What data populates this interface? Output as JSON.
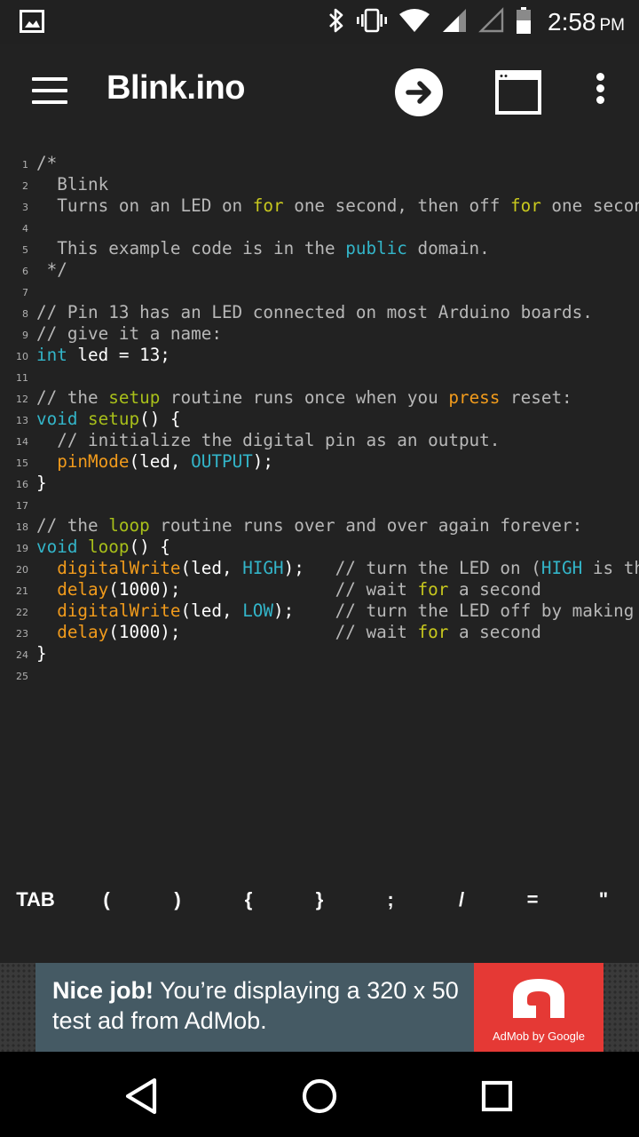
{
  "status_bar": {
    "time": "2:58",
    "ampm": "PM",
    "icons": [
      "image-notification-icon",
      "bluetooth-icon",
      "vibrate-icon",
      "wifi-icon",
      "signal-icon",
      "signal-empty-icon",
      "battery-icon"
    ]
  },
  "app_bar": {
    "title": "Blink.ino",
    "icons": [
      "menu-icon",
      "upload-arrow-icon",
      "serial-monitor-icon",
      "more-vert-icon"
    ]
  },
  "editor": {
    "lines": [
      {
        "n": "1",
        "tokens": [
          {
            "t": "/*",
            "c": "comment"
          }
        ]
      },
      {
        "n": "2",
        "tokens": [
          {
            "t": "  Blink",
            "c": "comment"
          }
        ]
      },
      {
        "n": "3",
        "tokens": [
          {
            "t": "  Turns on an LED on ",
            "c": "comment"
          },
          {
            "t": "for",
            "c": "keyword"
          },
          {
            "t": " one second, then off ",
            "c": "comment"
          },
          {
            "t": "for",
            "c": "keyword"
          },
          {
            "t": " one second, repeatedly.",
            "c": "comment"
          }
        ]
      },
      {
        "n": "4",
        "tokens": []
      },
      {
        "n": "5",
        "tokens": [
          {
            "t": "  This example code is in the ",
            "c": "comment"
          },
          {
            "t": "public",
            "c": "type"
          },
          {
            "t": " domain.",
            "c": "comment"
          }
        ]
      },
      {
        "n": "6",
        "tokens": [
          {
            "t": " */",
            "c": "comment"
          }
        ]
      },
      {
        "n": "7",
        "tokens": []
      },
      {
        "n": "8",
        "tokens": [
          {
            "t": "// Pin 13 has an LED connected on most Arduino boards.",
            "c": "comment"
          }
        ]
      },
      {
        "n": "9",
        "tokens": [
          {
            "t": "// give it a name:",
            "c": "comment"
          }
        ]
      },
      {
        "n": "10",
        "tokens": [
          {
            "t": "int",
            "c": "type"
          },
          {
            "t": " led = 13;",
            "c": "plain"
          }
        ]
      },
      {
        "n": "11",
        "tokens": []
      },
      {
        "n": "12",
        "tokens": [
          {
            "t": "// the ",
            "c": "comment"
          },
          {
            "t": "setup",
            "c": "kwgreen"
          },
          {
            "t": " routine runs once when you ",
            "c": "comment"
          },
          {
            "t": "press",
            "c": "func"
          },
          {
            "t": " reset:",
            "c": "comment"
          }
        ]
      },
      {
        "n": "13",
        "tokens": [
          {
            "t": "void",
            "c": "type"
          },
          {
            "t": " ",
            "c": "plain"
          },
          {
            "t": "setup",
            "c": "kwgreen"
          },
          {
            "t": "() {",
            "c": "plain"
          }
        ]
      },
      {
        "n": "14",
        "tokens": [
          {
            "t": "  // initialize the digital pin as an output.",
            "c": "comment"
          }
        ]
      },
      {
        "n": "15",
        "tokens": [
          {
            "t": "  ",
            "c": "plain"
          },
          {
            "t": "pinMode",
            "c": "func"
          },
          {
            "t": "(led, ",
            "c": "plain"
          },
          {
            "t": "OUTPUT",
            "c": "const"
          },
          {
            "t": ");",
            "c": "plain"
          }
        ]
      },
      {
        "n": "16",
        "tokens": [
          {
            "t": "}",
            "c": "plain"
          }
        ]
      },
      {
        "n": "17",
        "tokens": []
      },
      {
        "n": "18",
        "tokens": [
          {
            "t": "// the ",
            "c": "comment"
          },
          {
            "t": "loop",
            "c": "kwgreen"
          },
          {
            "t": " routine runs over and over again forever:",
            "c": "comment"
          }
        ]
      },
      {
        "n": "19",
        "tokens": [
          {
            "t": "void",
            "c": "type"
          },
          {
            "t": " ",
            "c": "plain"
          },
          {
            "t": "loop",
            "c": "kwgreen"
          },
          {
            "t": "() {",
            "c": "plain"
          }
        ]
      },
      {
        "n": "20",
        "tokens": [
          {
            "t": "  ",
            "c": "plain"
          },
          {
            "t": "digitalWrite",
            "c": "func"
          },
          {
            "t": "(led, ",
            "c": "plain"
          },
          {
            "t": "HIGH",
            "c": "const"
          },
          {
            "t": ");   ",
            "c": "plain"
          },
          {
            "t": "// turn the LED on (",
            "c": "comment"
          },
          {
            "t": "HIGH",
            "c": "const"
          },
          {
            "t": " is the voltage level)",
            "c": "comment"
          }
        ]
      },
      {
        "n": "21",
        "tokens": [
          {
            "t": "  ",
            "c": "plain"
          },
          {
            "t": "delay",
            "c": "func"
          },
          {
            "t": "(1000);               ",
            "c": "plain"
          },
          {
            "t": "// wait ",
            "c": "comment"
          },
          {
            "t": "for",
            "c": "keyword"
          },
          {
            "t": " a second",
            "c": "comment"
          }
        ]
      },
      {
        "n": "22",
        "tokens": [
          {
            "t": "  ",
            "c": "plain"
          },
          {
            "t": "digitalWrite",
            "c": "func"
          },
          {
            "t": "(led, ",
            "c": "plain"
          },
          {
            "t": "LOW",
            "c": "const"
          },
          {
            "t": ");    ",
            "c": "plain"
          },
          {
            "t": "// turn the LED off by making the voltage LOW",
            "c": "comment"
          }
        ]
      },
      {
        "n": "23",
        "tokens": [
          {
            "t": "  ",
            "c": "plain"
          },
          {
            "t": "delay",
            "c": "func"
          },
          {
            "t": "(1000);               ",
            "c": "plain"
          },
          {
            "t": "// wait ",
            "c": "comment"
          },
          {
            "t": "for",
            "c": "keyword"
          },
          {
            "t": " a second",
            "c": "comment"
          }
        ]
      },
      {
        "n": "24",
        "tokens": [
          {
            "t": "}",
            "c": "plain"
          }
        ]
      },
      {
        "n": "25",
        "tokens": []
      }
    ]
  },
  "symbol_bar": {
    "keys": [
      "TAB",
      "(",
      ")",
      "{",
      "}",
      ";",
      "/",
      "=",
      "\""
    ]
  },
  "ad": {
    "headline": "Nice job!",
    "body": " You’re displaying a 320 x 50 test ad from AdMob.",
    "logo_caption": "AdMob by Google",
    "colors": {
      "banner": "#455a64",
      "logo_bg": "#e53935"
    }
  },
  "nav_bar": {
    "icons": [
      "back-icon",
      "home-icon",
      "recents-icon"
    ]
  },
  "colors": {
    "background": "#222222",
    "comment": "#b8b8b8",
    "type": "#33b5c9",
    "keyword": "#c8c81e",
    "function": "#f19b1c"
  }
}
